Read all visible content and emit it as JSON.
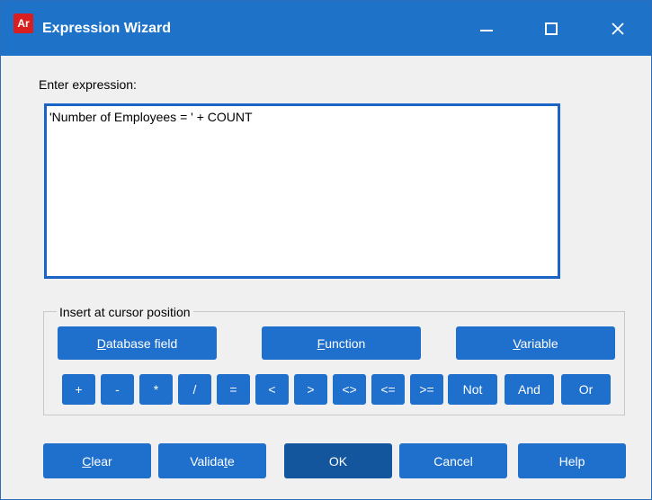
{
  "window": {
    "title": "Expression Wizard",
    "app_icon_text": "Ar"
  },
  "expression": {
    "label": "Enter expression:",
    "value": "'Number of Employees = ' + COUNT"
  },
  "insert_group": {
    "legend": "Insert at cursor position",
    "buttons": [
      {
        "label": "Database field",
        "accel": "D",
        "rest": "atabase field"
      },
      {
        "label": "Function",
        "accel": "F",
        "rest": "unction"
      },
      {
        "label": "Variable",
        "accel": "V",
        "rest": "ariable"
      }
    ],
    "operators": [
      "+",
      "-",
      "*",
      "/",
      "=",
      "<",
      ">",
      "<>",
      "<=",
      ">=",
      "Not",
      "And",
      "Or"
    ]
  },
  "footer": {
    "clear": {
      "accel": "C",
      "rest": "lear"
    },
    "validate": {
      "pre": "Valida",
      "accel": "t",
      "post": "e"
    },
    "ok": "OK",
    "cancel": "Cancel",
    "help": "Help"
  },
  "colors": {
    "title_bar": "#1e73c8",
    "button": "#1f6fcc",
    "default_button": "#14569e",
    "focus_border": "#1a64c8"
  }
}
